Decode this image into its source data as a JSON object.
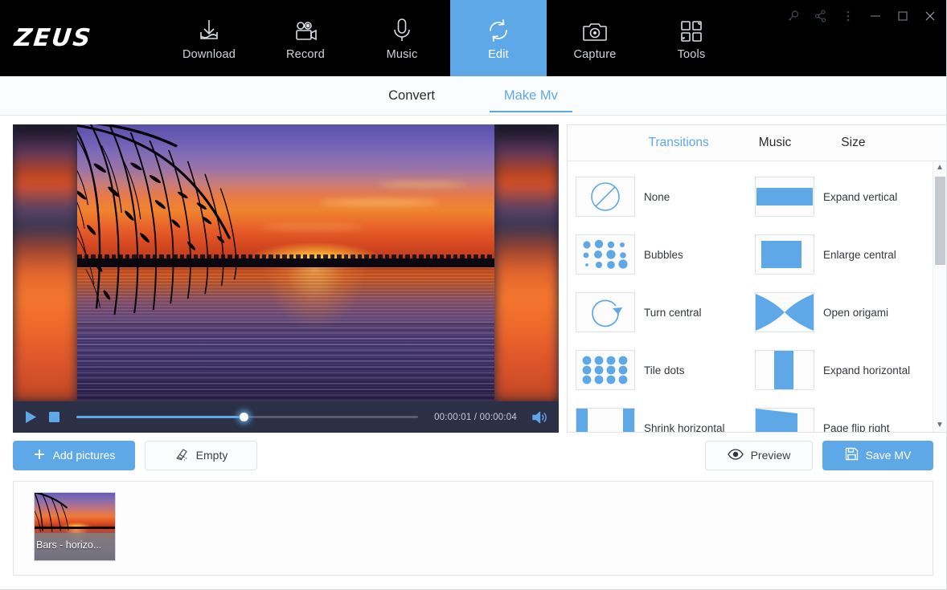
{
  "app": {
    "logo": "ZEUS",
    "accent": "#5FA8E8",
    "topbar_bg": "#000000"
  },
  "nav": {
    "items": [
      {
        "label": "Download",
        "icon": "download-icon",
        "active": false
      },
      {
        "label": "Record",
        "icon": "video-camera-icon",
        "active": false
      },
      {
        "label": "Music",
        "icon": "microphone-icon",
        "active": false
      },
      {
        "label": "Edit",
        "icon": "edit-refresh-icon",
        "active": true
      },
      {
        "label": "Capture",
        "icon": "camera-icon",
        "active": false
      },
      {
        "label": "Tools",
        "icon": "grid-tools-icon",
        "active": false
      }
    ]
  },
  "window_controls": [
    {
      "name": "search-icon"
    },
    {
      "name": "share-icon"
    },
    {
      "name": "more-vertical-icon"
    },
    {
      "name": "minimize-icon"
    },
    {
      "name": "maximize-icon"
    },
    {
      "name": "close-icon"
    }
  ],
  "subtabs": [
    {
      "label": "Convert",
      "active": false
    },
    {
      "label": "Make Mv",
      "active": true
    }
  ],
  "player": {
    "current_time": "00:00:01",
    "total_time": "00:00:04",
    "time_display": "00:00:01 / 00:00:04",
    "progress_percent": 49,
    "play_icon": "play-icon",
    "stop_icon": "stop-icon",
    "volume_icon": "volume-on-icon"
  },
  "right_panel": {
    "tabs": [
      {
        "label": "Transitions",
        "active": true
      },
      {
        "label": "Music",
        "active": false
      },
      {
        "label": "Size",
        "active": false
      }
    ],
    "transitions": [
      {
        "label": "None",
        "icon": "none-circle-slash-icon"
      },
      {
        "label": "Expand vertical",
        "icon": "expand-vertical-icon"
      },
      {
        "label": "Bubbles",
        "icon": "bubbles-icon"
      },
      {
        "label": "Enlarge central",
        "icon": "enlarge-central-icon"
      },
      {
        "label": "Turn central",
        "icon": "turn-central-icon"
      },
      {
        "label": "Open origami",
        "icon": "open-origami-icon"
      },
      {
        "label": "Tile dots",
        "icon": "tile-dots-icon"
      },
      {
        "label": "Expand horizontal",
        "icon": "expand-horizontal-icon"
      },
      {
        "label": "Shrink horizontal",
        "icon": "shrink-horizontal-icon"
      },
      {
        "label": "Page flip right",
        "icon": "page-flip-right-icon"
      }
    ],
    "scrollbar": {
      "up_glyph": "▲",
      "down_glyph": "▼"
    }
  },
  "actions": {
    "add_pictures": {
      "label": "Add pictures",
      "icon": "plus-icon"
    },
    "empty": {
      "label": "Empty",
      "icon": "broom-icon"
    },
    "preview": {
      "label": "Preview",
      "icon": "eye-icon"
    },
    "save_mv": {
      "label": "Save MV",
      "icon": "floppy-disk-icon"
    }
  },
  "timeline": {
    "items": [
      {
        "caption": "Bars - horizo..."
      }
    ]
  }
}
